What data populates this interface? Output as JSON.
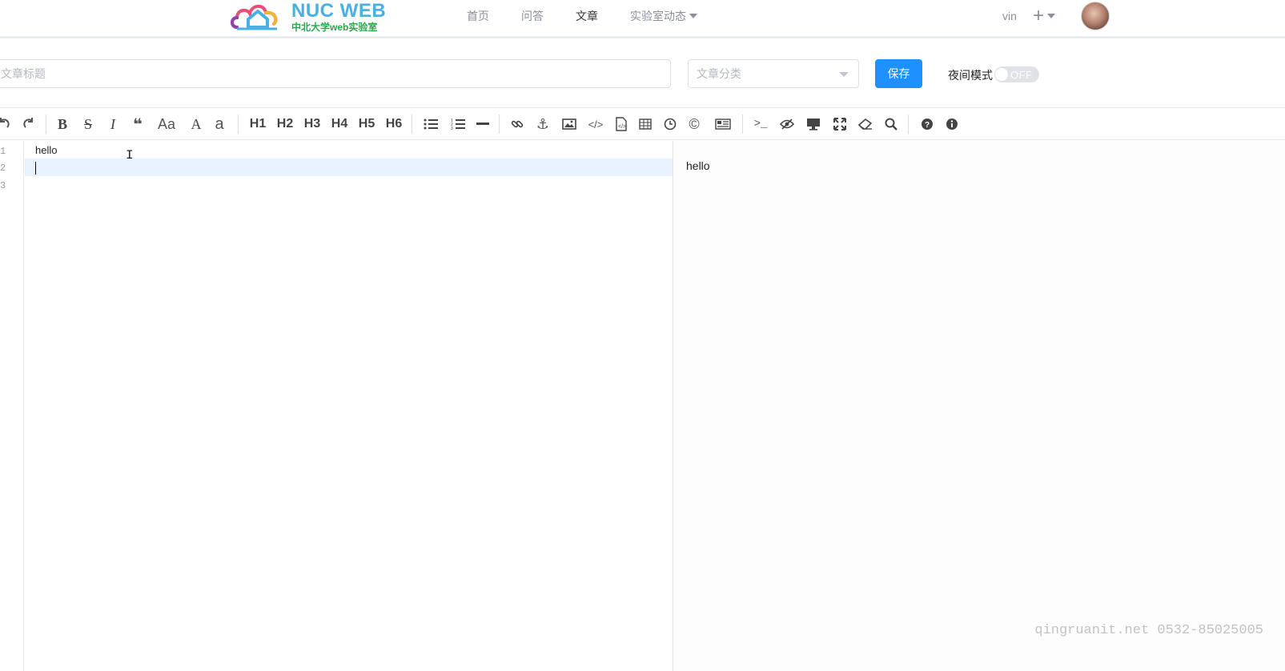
{
  "header": {
    "logo_title": "NUC WEB",
    "logo_subtitle": "中北大学web实验室",
    "nav": [
      {
        "label": "首页",
        "active": false
      },
      {
        "label": "问答",
        "active": false
      },
      {
        "label": "文章",
        "active": true
      },
      {
        "label": "实验室动态",
        "active": false,
        "has_dropdown": true
      }
    ],
    "user_name": "vin",
    "add_icon": "+"
  },
  "form": {
    "title_placeholder": "文章标题",
    "category_placeholder": "文章分类",
    "save_label": "保存",
    "night_mode_label": "夜间模式",
    "night_mode_state": "OFF"
  },
  "toolbar": {
    "heading_labels": [
      "H1",
      "H2",
      "H3",
      "H4",
      "H5",
      "H6"
    ],
    "case_upper": "Aa",
    "font_a": "A",
    "font_a_lower": "a"
  },
  "editor": {
    "line_numbers": [
      "1",
      "2",
      "3"
    ],
    "lines": [
      "hello",
      "",
      ""
    ],
    "preview_text": "hello"
  },
  "watermark": "qingruanit.net 0532-85025005",
  "colors": {
    "accent": "#1e90ff",
    "logo_blue": "#48b0e2",
    "logo_green": "#2aa84a",
    "active_line": "#e8f2fe"
  }
}
